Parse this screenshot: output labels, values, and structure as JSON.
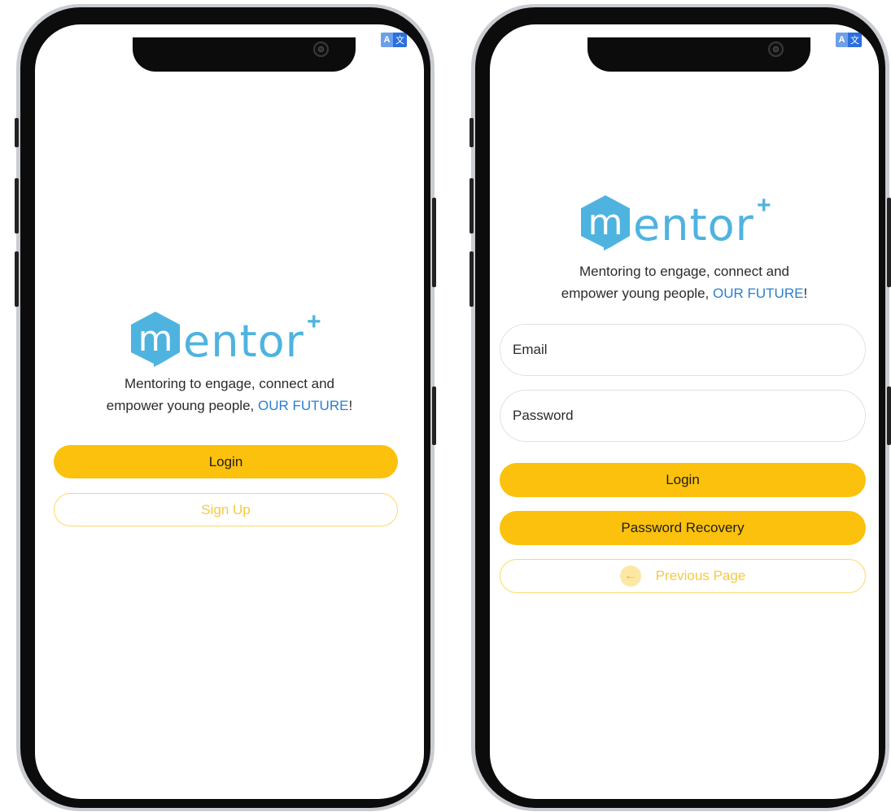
{
  "app": {
    "name": "mentor",
    "plus": "+",
    "tagline_line1": "Mentoring to engage, connect and",
    "tagline_line2_prefix": "empower young people,",
    "tagline_highlight": "OUR FUTURE",
    "tagline_suffix": "!",
    "brand_color": "#4fb3e0",
    "accent_color": "#fcc10d",
    "highlight_color": "#2a7fd0"
  },
  "translate_badge": {
    "left_glyph": "A",
    "right_glyph": "文",
    "icon": "translate-icon"
  },
  "welcome_screen": {
    "login_label": "Login",
    "signup_label": "Sign Up"
  },
  "login_screen": {
    "email_placeholder": "Email",
    "password_placeholder": "Password",
    "login_label": "Login",
    "recovery_label": "Password Recovery",
    "previous_label": "Previous Page",
    "back_icon": "arrow-left-icon"
  }
}
